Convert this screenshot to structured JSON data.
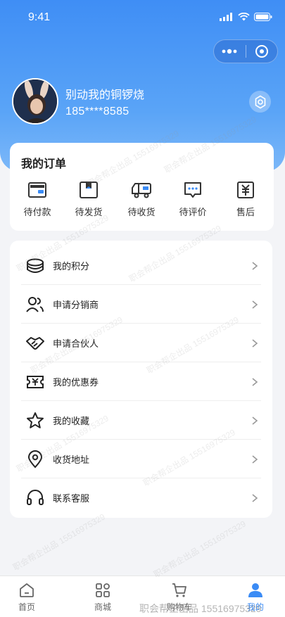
{
  "status_bar": {
    "time": "9:41"
  },
  "profile": {
    "name": "别动我的铜锣烧",
    "phone": "185****8585"
  },
  "orders": {
    "title": "我的订单",
    "items": [
      {
        "label": "待付款",
        "icon": "wallet-icon"
      },
      {
        "label": "待发货",
        "icon": "package-icon"
      },
      {
        "label": "待收货",
        "icon": "truck-icon"
      },
      {
        "label": "待评价",
        "icon": "comment-icon"
      },
      {
        "label": "售后",
        "icon": "after-sale-icon"
      }
    ]
  },
  "menu": [
    {
      "label": "我的积分",
      "icon": "coins-icon"
    },
    {
      "label": "申请分销商",
      "icon": "users-icon"
    },
    {
      "label": "申请合伙人",
      "icon": "handshake-icon"
    },
    {
      "label": "我的优惠券",
      "icon": "coupon-icon"
    },
    {
      "label": "我的收藏",
      "icon": "star-icon"
    },
    {
      "label": "收货地址",
      "icon": "location-icon"
    },
    {
      "label": "联系客服",
      "icon": "headset-icon"
    }
  ],
  "tabbar": [
    {
      "label": "首页",
      "icon": "home-icon",
      "active": false
    },
    {
      "label": "商城",
      "icon": "grid-icon",
      "active": false
    },
    {
      "label": "购物车",
      "icon": "cart-icon",
      "active": false
    },
    {
      "label": "我的",
      "icon": "user-icon",
      "active": true
    }
  ],
  "watermark": {
    "text": "职会帮企出品  15516975329"
  },
  "colors": {
    "primary": "#3a8bf5",
    "hero_start": "#3f8ef5",
    "background": "#f3f4f7"
  }
}
